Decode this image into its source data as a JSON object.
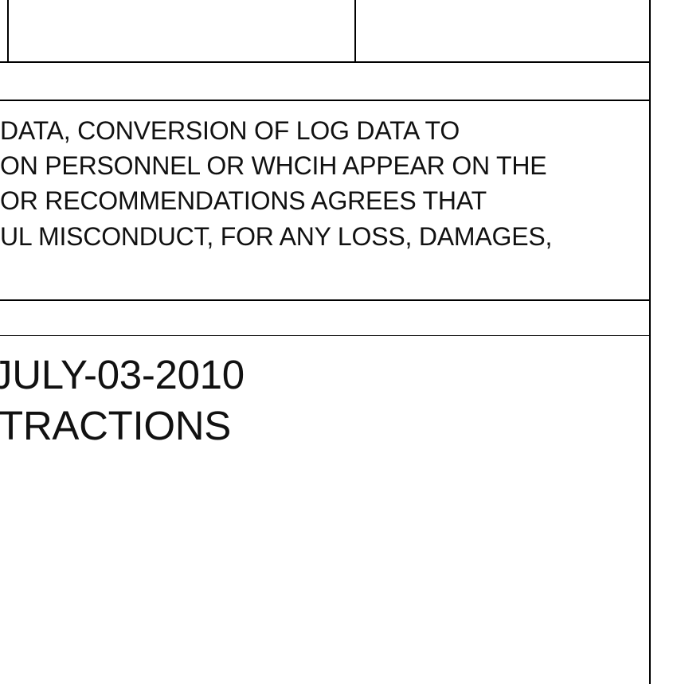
{
  "disclaimer": {
    "lines": [
      " DATA, CONVERSION OF LOG DATA TO",
      "ON PERSONNEL OR WHCIH APPEAR ON THE",
      "OR RECOMMENDATIONS AGREES THAT",
      "UL MISCONDUCT, FOR ANY LOSS, DAMAGES,"
    ]
  },
  "header": {
    "lines": [
      "JULY-03-2010",
      "TRACTIONS"
    ]
  }
}
